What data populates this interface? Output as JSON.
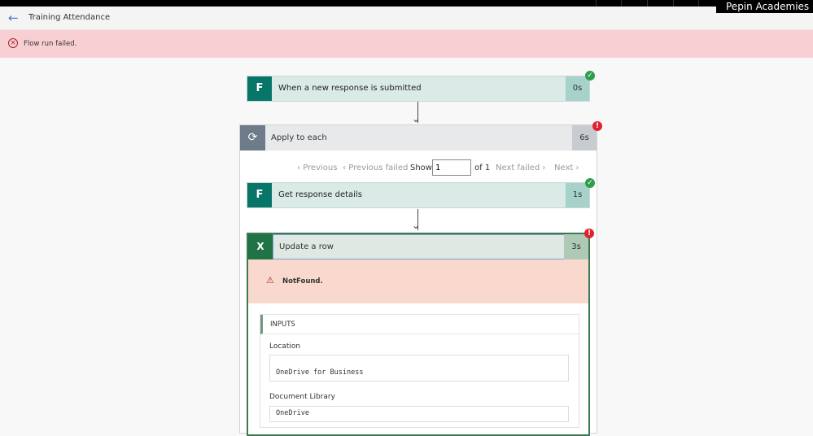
{
  "top_bar": {
    "tenant": "Pepin Academies (de"
  },
  "header": {
    "back_icon": "arrow-left-icon",
    "title": "Training Attendance"
  },
  "banner": {
    "icon": "error-circle-icon",
    "text": "Flow run failed."
  },
  "trigger": {
    "label": "When a new response is submitted",
    "duration": "0s",
    "status": "success",
    "icon": "forms-icon",
    "icon_letter": "F"
  },
  "loop": {
    "label": "Apply to each",
    "duration": "6s",
    "status": "failed",
    "icon": "loop-icon",
    "pager": {
      "previous": "Previous",
      "previous_failed": "Previous failed",
      "show": "Show",
      "current": "1",
      "of": "of 1",
      "next_failed": "Next failed",
      "next": "Next"
    }
  },
  "get_details": {
    "label": "Get response details",
    "duration": "1s",
    "status": "success",
    "icon_letter": "F"
  },
  "update_row": {
    "label": "Update a row",
    "duration": "3s",
    "status": "failed",
    "icon_letter": "X",
    "error": "NotFound.",
    "inputs": {
      "heading": "INPUTS",
      "fields": [
        {
          "label": "Location",
          "value": "OneDrive for Business"
        },
        {
          "label": "Document Library",
          "value": "OneDrive"
        }
      ]
    }
  },
  "colors": {
    "forms": "#077568",
    "excel": "#217346",
    "error_banner": "#f8d0d3",
    "error_box": "#f9d9ce",
    "success": "#2e9e4a",
    "failed": "#e0212e"
  }
}
